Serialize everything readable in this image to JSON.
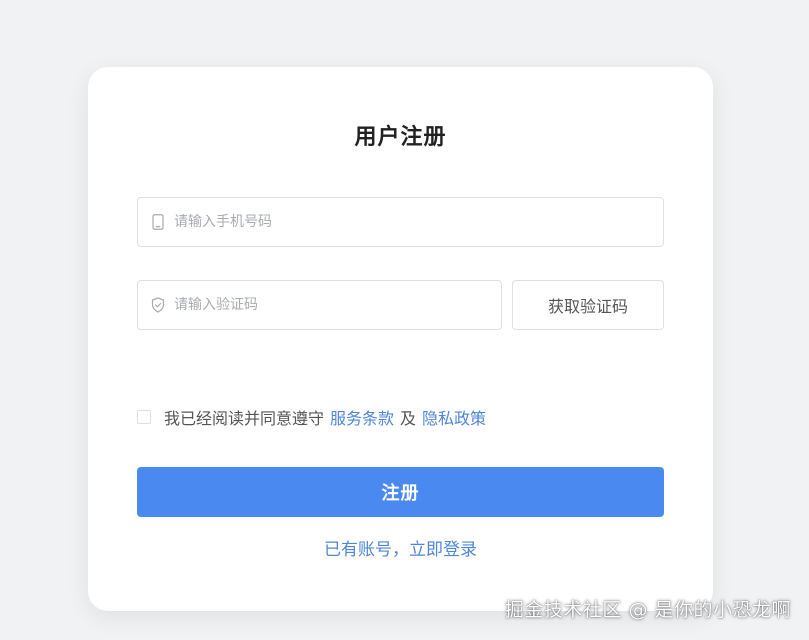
{
  "form": {
    "title": "用户注册",
    "phone": {
      "placeholder": "请输入手机号码",
      "value": "",
      "icon": "mobile-icon"
    },
    "code": {
      "placeholder": "请输入验证码",
      "value": "",
      "icon": "shield-icon"
    },
    "get_code_label": "获取验证码",
    "agreement": {
      "checked": false,
      "prefix": "我已经阅读并同意遵守",
      "terms_link": "服务条款",
      "conjunction": "及",
      "privacy_link": "隐私政策"
    },
    "submit_label": "注册",
    "login_link": "已有账号，立即登录"
  },
  "watermark": "掘金技术社区 @ 是你的小恐龙啊",
  "colors": {
    "background": "#f1f2f4",
    "card": "#ffffff",
    "primary": "#4a89f0",
    "link": "#4f86d8",
    "border": "#dcdfe6",
    "placeholder": "#a8abb2"
  }
}
